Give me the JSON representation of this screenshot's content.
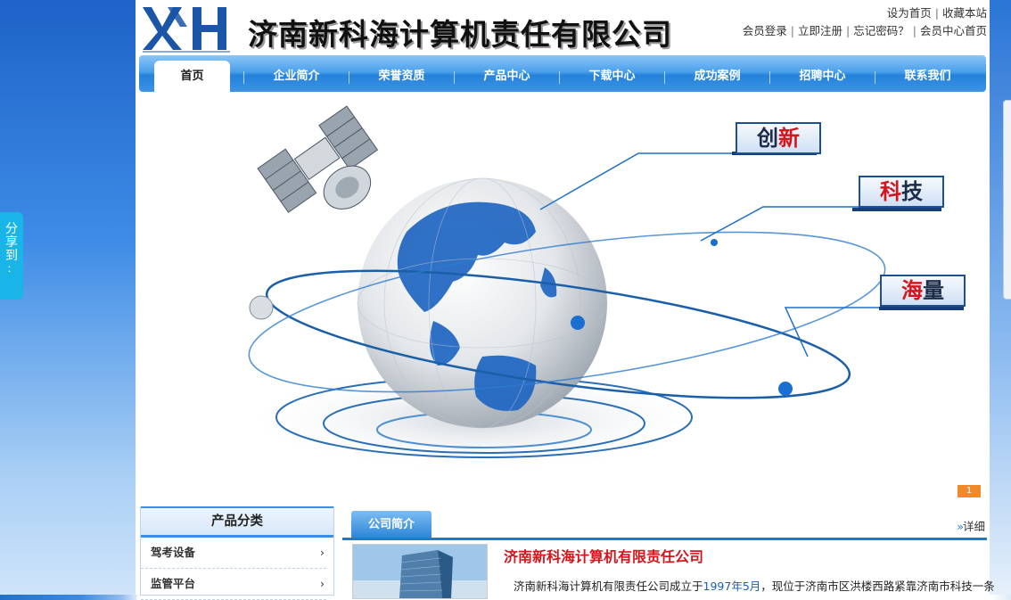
{
  "share": {
    "label": [
      "分",
      "享",
      "到",
      "：",
      ""
    ]
  },
  "header": {
    "company_name": "济南新科海计算机责任有限公司",
    "links_row1": [
      "设为首页",
      "收藏本站"
    ],
    "links_row2": [
      "会员登录",
      "立即注册",
      "忘记密码？",
      "会员中心首页"
    ]
  },
  "nav": {
    "items": [
      "首页",
      "企业简介",
      "荣誉资质",
      "产品中心",
      "下载中心",
      "成功案例",
      "招聘中心",
      "联系我们"
    ],
    "active": "首页"
  },
  "banner": {
    "tags": [
      {
        "first": "创",
        "second": "新"
      },
      {
        "first": "科",
        "second": "技"
      },
      {
        "first": "海",
        "second": "量"
      }
    ]
  },
  "sidebar": {
    "title": "产品分类",
    "items": [
      "驾考设备",
      "监管平台"
    ]
  },
  "intro": {
    "tab": "公司简介",
    "more": "详细",
    "title": "济南新科海计算机有限责任公司",
    "text_prefix": "济南新科海计算机有限责任公司成立于",
    "text_highlight": "1997年5月",
    "text_suffix": "，现位于济南市区洪楼西路紧靠济南市科技一条"
  },
  "colors": {
    "nav": "#2482db",
    "accent_red": "#d3161c",
    "share_tab": "#19b5e8"
  }
}
